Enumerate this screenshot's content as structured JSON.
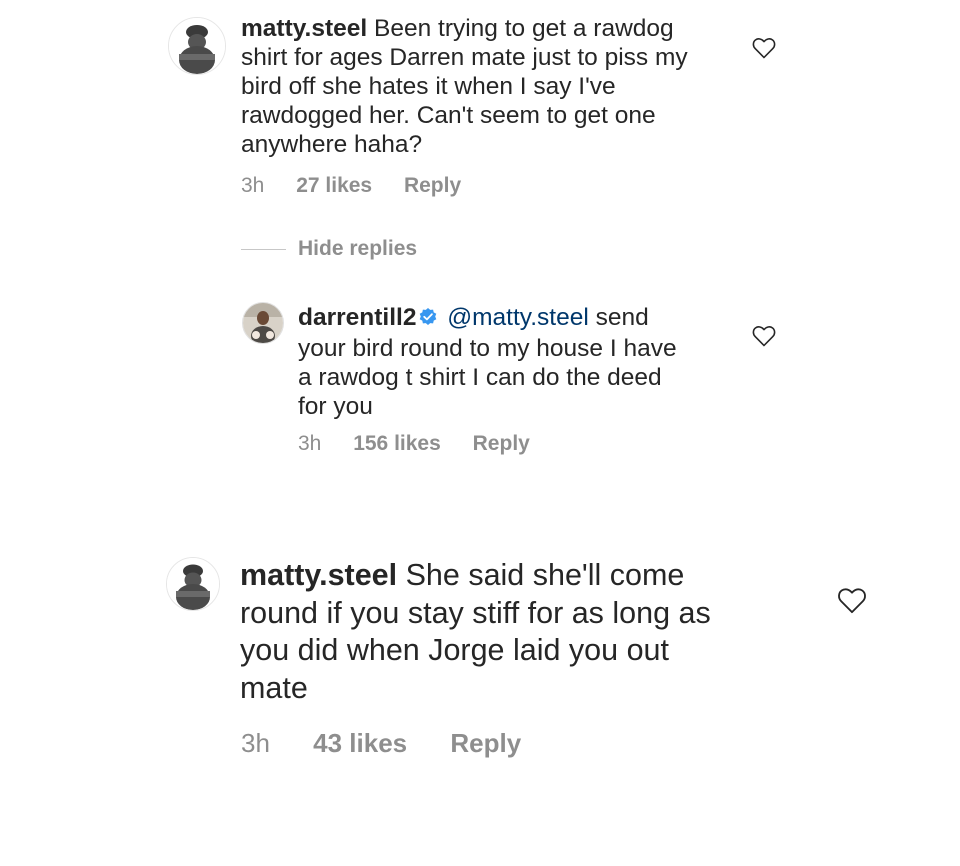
{
  "comments": [
    {
      "username": "matty.steel",
      "text": "Been trying to get a rawdog shirt for ages Darren mate just to piss my bird off she hates it when I say I've rawdogged her. Can't seem to get one anywhere haha?",
      "lines": [
        "Been trying to get a rawdog",
        "shirt for ages Darren mate just to piss my",
        "bird off she hates it when I say I've",
        "rawdogged her. Can't seem to get one",
        "anywhere haha?"
      ],
      "time": "3h",
      "likes": "27 likes",
      "reply_label": "Reply",
      "heart_icon": "heart-outline-icon"
    },
    {
      "username": "darrentill2",
      "verified": true,
      "mention": "@matty.steel",
      "text": "send your bird round to my house I have a rawdog t shirt I can do the deed for you",
      "lines": [
        "send",
        "your bird round to my house I have",
        "a rawdog t shirt I can do the deed",
        "for you"
      ],
      "time": "3h",
      "likes": "156 likes",
      "reply_label": "Reply",
      "heart_icon": "heart-outline-icon"
    },
    {
      "username": "matty.steel",
      "text": "She said she'll come round if you stay stiff for as long as you did when Jorge laid you out mate",
      "lines": [
        "She said she'll come",
        "round if you stay stiff for as long as",
        "you did when Jorge laid you out",
        "mate"
      ],
      "time": "3h",
      "likes": "43 likes",
      "reply_label": "Reply",
      "heart_icon": "heart-outline-icon"
    }
  ],
  "hide_replies_label": "Hide replies",
  "colors": {
    "text": "#262626",
    "secondary": "#8e8e8e",
    "mention": "#00376b",
    "verified": "#3897f0"
  }
}
